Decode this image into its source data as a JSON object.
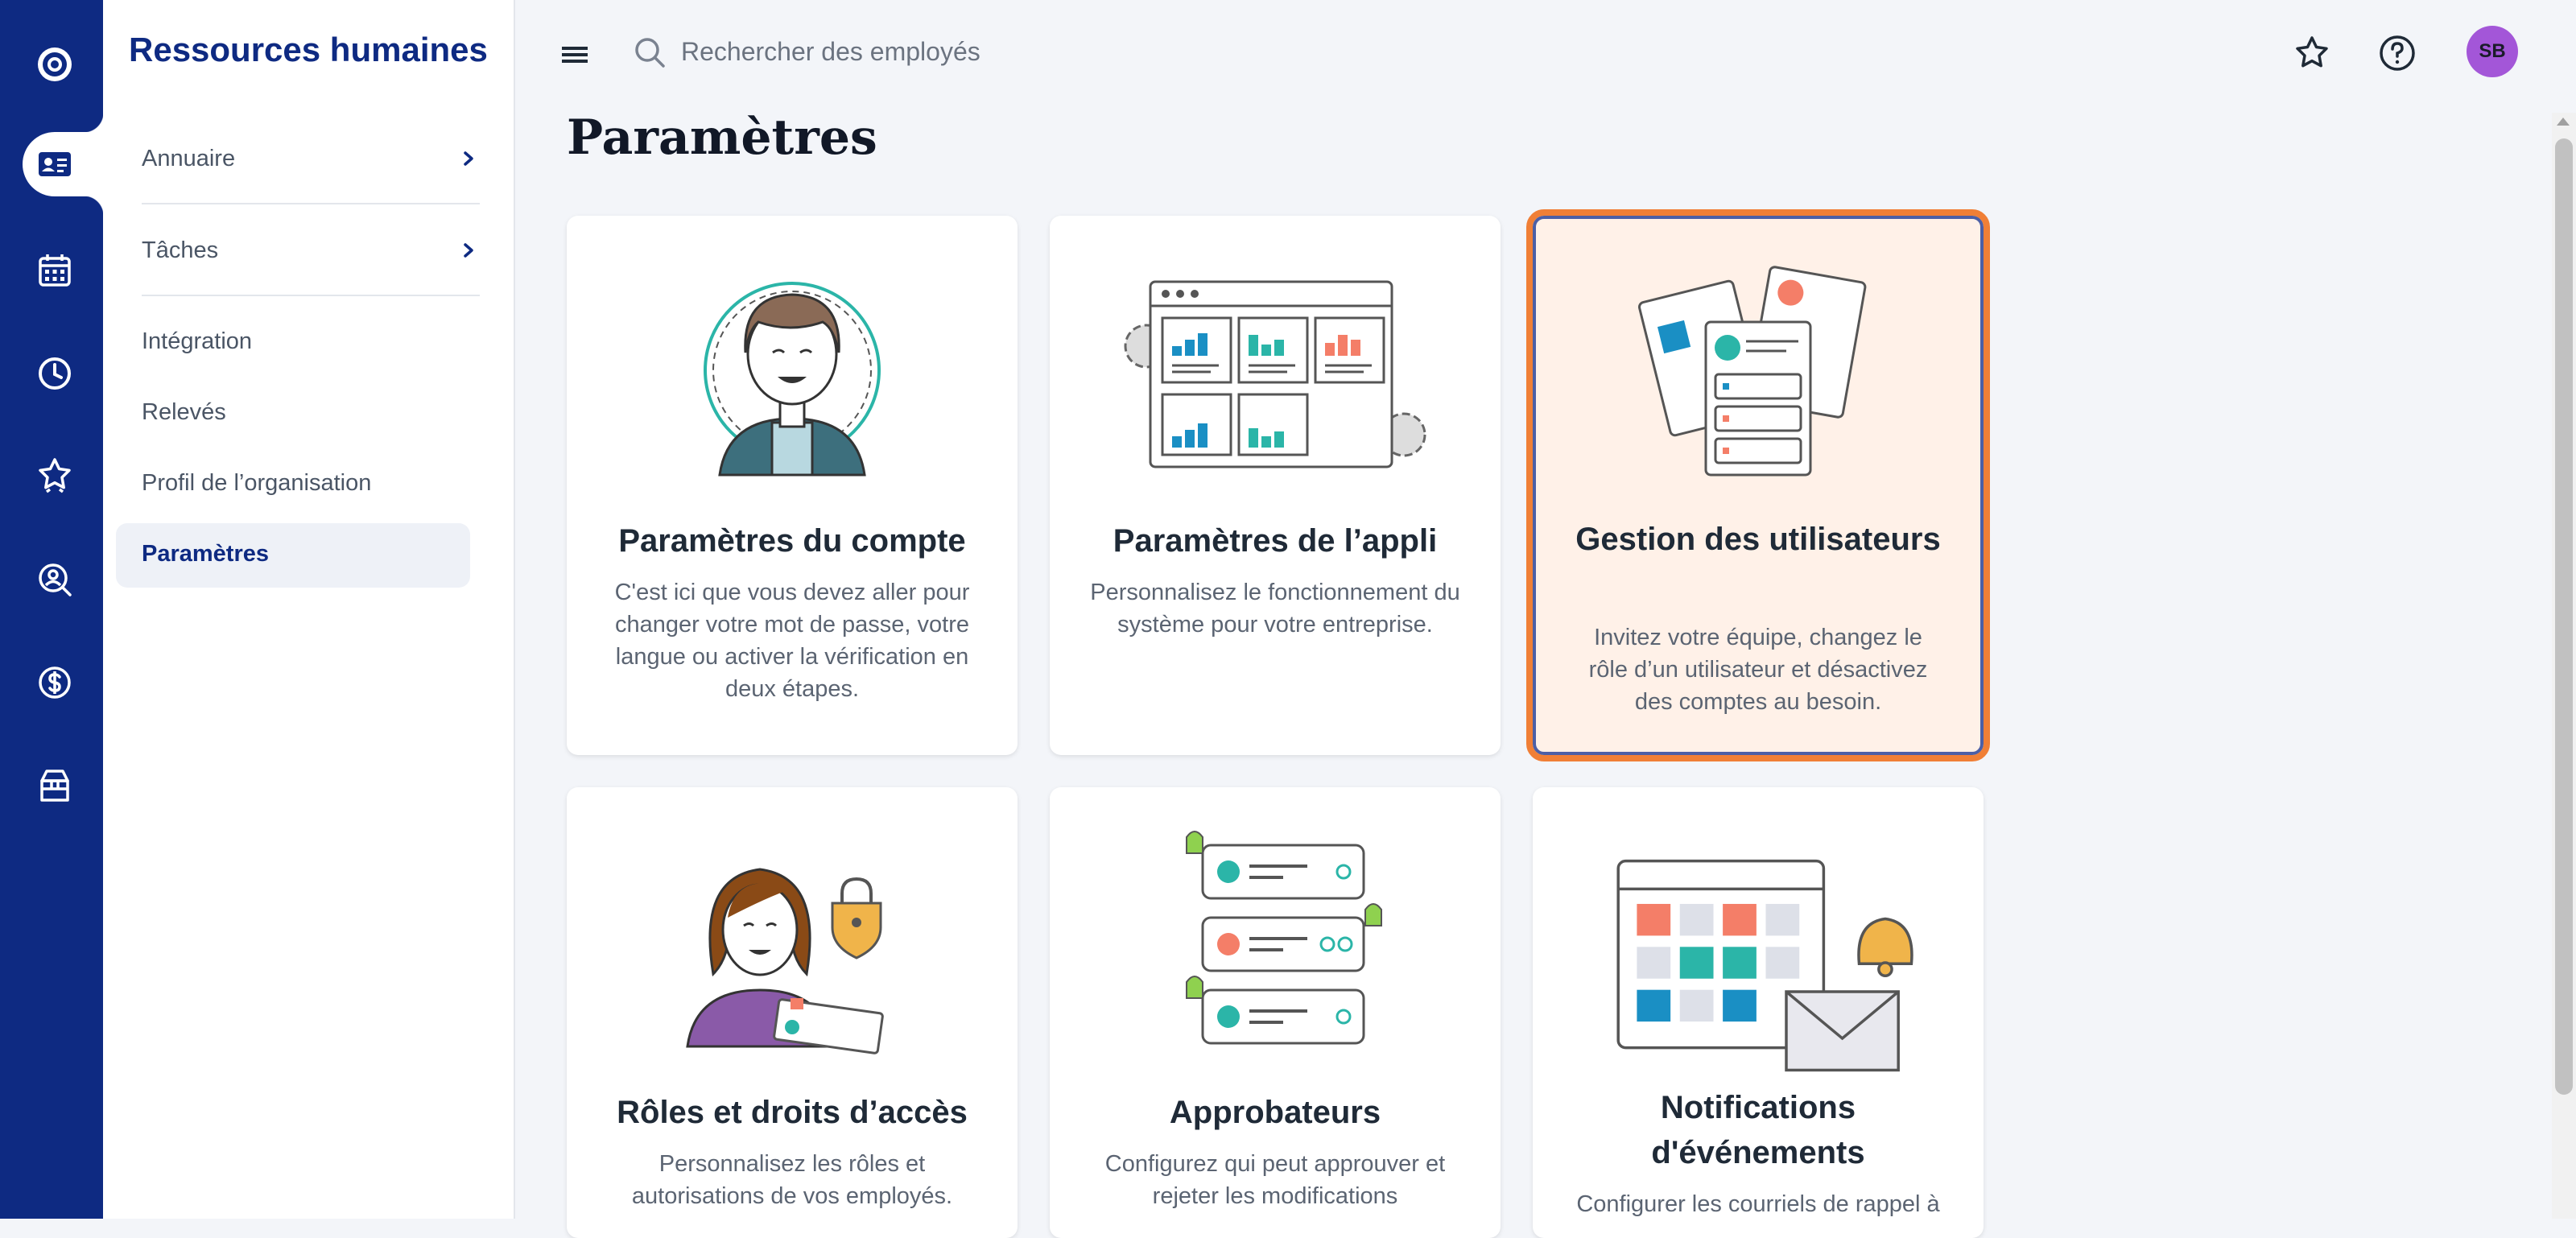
{
  "app": {
    "name": "Ressources humaines"
  },
  "rail": {
    "icons": [
      "logo-icon",
      "employee-card-icon",
      "calendar-icon",
      "clock-icon",
      "star-badge-icon",
      "person-search-icon",
      "dollar-icon",
      "box-icon"
    ],
    "active": "employee-card-icon"
  },
  "sidebar": {
    "expandable": [
      {
        "label": "Annuaire"
      },
      {
        "label": "Tâches"
      }
    ],
    "items": [
      {
        "label": "Intégration"
      },
      {
        "label": "Relevés"
      },
      {
        "label": "Profil de l’organisation"
      },
      {
        "label": "Paramètres",
        "active": true
      }
    ]
  },
  "topbar": {
    "search_placeholder": "Rechercher des employés",
    "avatar_initials": "SB"
  },
  "page": {
    "title": "Paramètres"
  },
  "cards": [
    {
      "title": "Paramètres du compte",
      "description": "C'est ici que vous devez aller pour changer votre mot de passe, votre langue ou activer la vérification en deux étapes."
    },
    {
      "title": "Paramètres de l’appli",
      "description": "Personnalisez le fonctionnement du système pour votre entreprise."
    },
    {
      "title": "Gestion des utilisateurs",
      "description": "Invitez votre équipe, changez le rôle d’un utilisateur et désactivez des comptes au besoin.",
      "selected": true
    },
    {
      "title": "Rôles et droits d’accès",
      "description": "Personnalisez les rôles et autorisations de vos employés."
    },
    {
      "title": "Approbateurs",
      "description": "Configurez qui peut approuver et rejeter les modifications"
    },
    {
      "title": "Notifications d'événements",
      "description": "Configurer les courriels de rappel à"
    }
  ],
  "colors": {
    "rail": "#0e2a82",
    "accent_orange": "#f07f36",
    "selected_card_bg": "#fff1e8",
    "avatar": "#a356d8",
    "teal": "#2bb5a8",
    "coral": "#f47e68"
  }
}
